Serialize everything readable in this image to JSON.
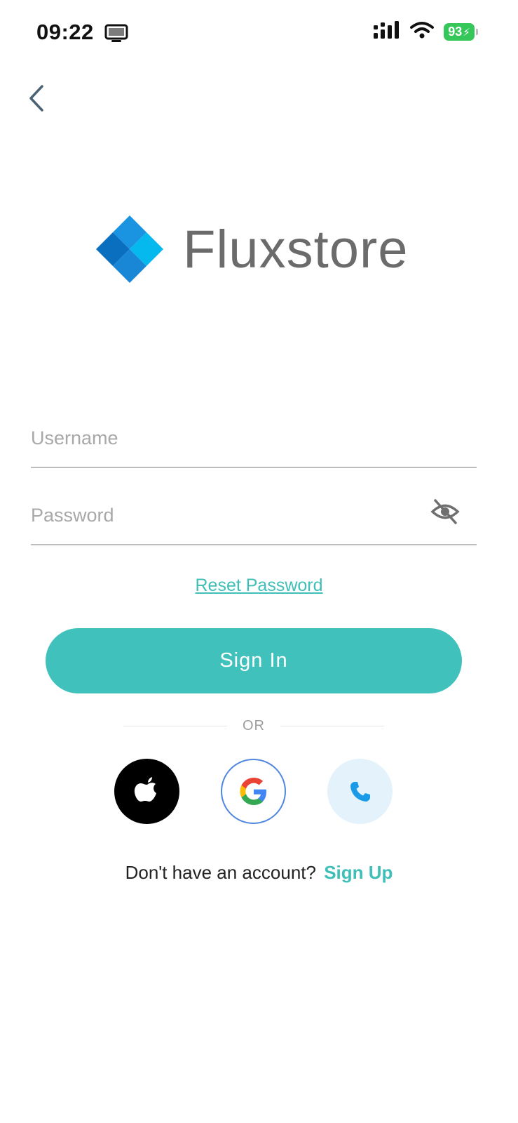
{
  "status_bar": {
    "time": "09:22",
    "battery_level": "93"
  },
  "logo": {
    "brand_name": "Fluxstore",
    "colors": [
      "#0a6fbf",
      "#1a93e0",
      "#05b9ee"
    ]
  },
  "form": {
    "username_placeholder": "Username",
    "password_placeholder": "Password",
    "reset_label": "Reset Password",
    "signin_label": "Sign In"
  },
  "divider": {
    "label": "OR"
  },
  "social": {
    "apple_icon": "apple-icon",
    "google_icon": "google-icon",
    "phone_icon": "phone-icon"
  },
  "signup": {
    "prompt": "Don't have an account?",
    "link_label": "Sign Up"
  },
  "colors": {
    "accent": "#41c1bb",
    "link": "#3fbfb8",
    "google_border": "#4f87e0",
    "phone_bg": "#e3f2fb"
  }
}
